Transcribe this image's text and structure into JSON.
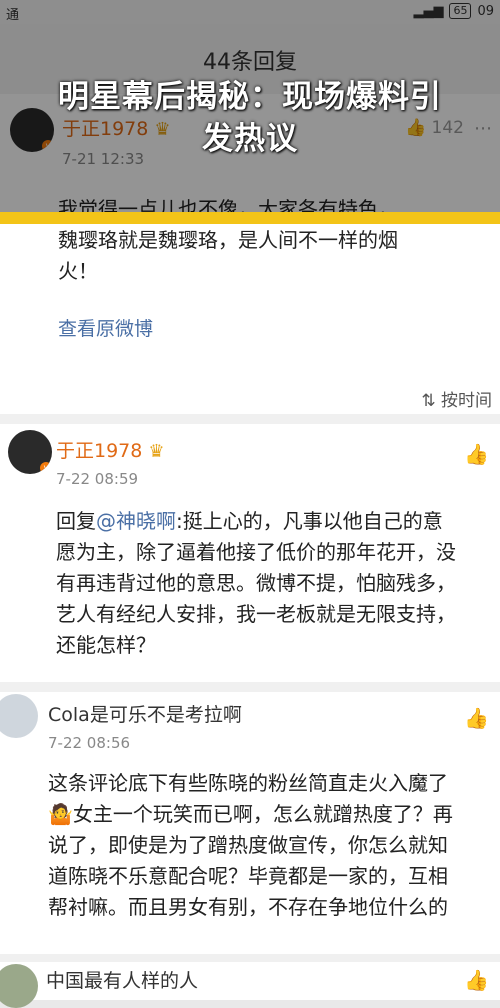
{
  "status_bar": {
    "left_text": "通",
    "battery": "65",
    "time": "09"
  },
  "nav": {
    "title": "44条回复"
  },
  "overlay": {
    "headline_line1": "明星幕后揭秘：现场爆料引",
    "headline_line2": "发热议"
  },
  "original": {
    "user": "于正1978",
    "time": "7-21 12:33",
    "like_count": "142",
    "text_line1": "我觉得一点儿也不像，大家各有特色，",
    "text_line2": "魏璎珞就是魏璎珞，是人间不一样的烟",
    "text_line3": "火！",
    "view_original": "查看原微博"
  },
  "sort_label": "按时间",
  "comments": [
    {
      "user": "于正1978",
      "time": "7-22 08:59",
      "reply_prefix": "回复",
      "mention": "@神晓啊",
      "lines": [
        "回复@神晓啊:挺上心的，凡事以他自己的意",
        "愿为主，除了逼着他接了低价的那年花开，没",
        "有再违背过他的意思。微博不提，怕脑残多，",
        "艺人有经纪人安排，我一老板就是无限支持，",
        "还能怎样？"
      ]
    },
    {
      "user": "Cola是可乐不是考拉啊",
      "time": "7-22 08:56",
      "lines": [
        "这条评论底下有些陈晓的粉丝简直走火入魔了",
        "女主一个玩笑而已啊，怎么就蹭热度了？再",
        "说了，即使是为了蹭热度做宣传，你怎么就知",
        "道陈晓不乐意配合呢？毕竟都是一家的，互相",
        "帮衬嘛。而且男女有别，不存在争地位什么的"
      ]
    },
    {
      "user": "中国最有人样的人"
    }
  ],
  "icons": {
    "like": "thumbs-up-icon",
    "crown": "crown-icon",
    "sort": "sort-icon"
  },
  "colors": {
    "accent": "#f3c418",
    "username": "#e06a16",
    "link": "#4a6fa5"
  }
}
